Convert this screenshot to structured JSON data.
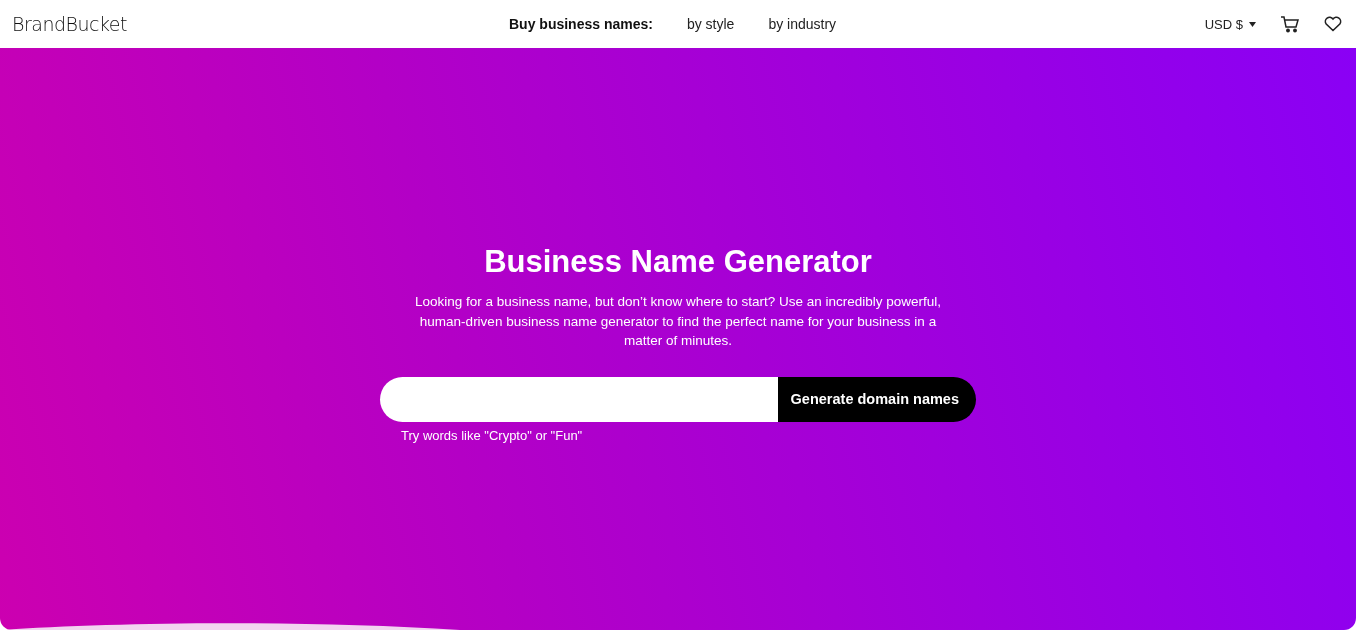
{
  "header": {
    "logo": "BrandBucket",
    "nav_label": "Buy business names:",
    "nav_links": [
      "by style",
      "by industry"
    ],
    "currency": "USD $"
  },
  "hero": {
    "title": "Business Name Generator",
    "description": "Looking for a business name, but don’t know where to start? Use an incredibly powerful, human-driven business name generator to find the perfect name for your business in a matter of minutes.",
    "search": {
      "button": "Generate domain names"
    },
    "hint": "Try words like \"Crypto\" or \"Fun\""
  }
}
